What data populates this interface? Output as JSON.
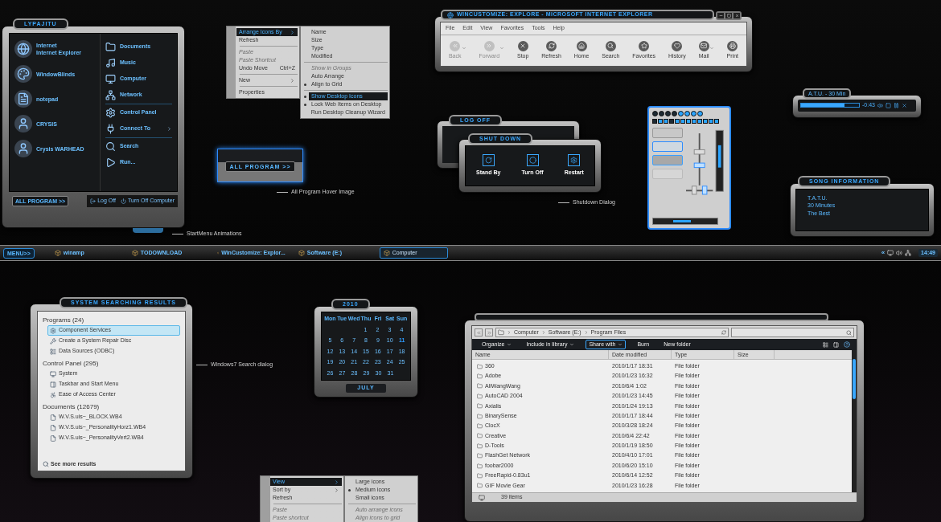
{
  "start_menu": {
    "user": "LYPAJITU",
    "pinned": [
      {
        "title": "Internet",
        "subtitle": "Internet Explorer"
      },
      {
        "title": "WindowBlinds"
      },
      {
        "title": "notepad"
      },
      {
        "title": "CRYSIS"
      },
      {
        "title": "Crysis WARHEAD"
      }
    ],
    "place_groups": [
      {
        "items": [
          {
            "label": "Documents",
            "has_submenu": false
          },
          {
            "label": "Music",
            "has_submenu": false
          },
          {
            "label": "Computer",
            "has_submenu": false
          },
          {
            "label": "Network",
            "has_submenu": false
          }
        ]
      },
      {
        "items": [
          {
            "label": "Control Panel",
            "has_submenu": false
          },
          {
            "label": "Connect To",
            "has_submenu": true
          }
        ]
      },
      {
        "items": [
          {
            "label": "Search",
            "has_submenu": false
          },
          {
            "label": "Run...",
            "has_submenu": false
          }
        ]
      }
    ],
    "all_programs": "ALL PROGRAM >>",
    "log_off": "Log Off",
    "turn_off": "Turn Off Computer",
    "note": "StartMenu Animations"
  },
  "desktop_menu": {
    "items": [
      {
        "kind": "item",
        "label": "Arrange Icons By",
        "selected": true,
        "disabled": false,
        "has_submenu": true
      },
      {
        "kind": "item",
        "label": "Refresh",
        "selected": false,
        "disabled": false,
        "has_submenu": false
      },
      {
        "kind": "separator"
      },
      {
        "kind": "item",
        "label": "Paste",
        "selected": false,
        "disabled": true,
        "has_submenu": false
      },
      {
        "kind": "item",
        "label": "Paste Shortcut",
        "selected": false,
        "disabled": true,
        "has_submenu": false
      },
      {
        "kind": "item",
        "label": "Undo Move",
        "shortcut": "Ctrl+Z",
        "selected": false,
        "disabled": false,
        "has_submenu": false
      },
      {
        "kind": "separator"
      },
      {
        "kind": "item",
        "label": "New",
        "selected": false,
        "disabled": false,
        "has_submenu": true
      },
      {
        "kind": "separator"
      },
      {
        "kind": "item",
        "label": "Properties",
        "selected": false,
        "disabled": false,
        "has_submenu": false
      }
    ],
    "submenu": [
      {
        "kind": "item",
        "label": "Name",
        "selected": false,
        "disabled": false,
        "checked": false
      },
      {
        "kind": "item",
        "label": "Size",
        "selected": false,
        "disabled": false,
        "checked": false
      },
      {
        "kind": "item",
        "label": "Type",
        "selected": false,
        "disabled": false,
        "checked": false
      },
      {
        "kind": "item",
        "label": "Modified",
        "selected": false,
        "disabled": false,
        "checked": false
      },
      {
        "kind": "separator"
      },
      {
        "kind": "item",
        "label": "Show in Groups",
        "selected": false,
        "disabled": true,
        "checked": false
      },
      {
        "kind": "item",
        "label": "Auto Arrange",
        "selected": false,
        "disabled": false,
        "checked": false
      },
      {
        "kind": "item",
        "label": "Align to Grid",
        "selected": false,
        "disabled": false,
        "checked": true
      },
      {
        "kind": "separator"
      },
      {
        "kind": "item",
        "label": "Show Desktop Icons",
        "selected": true,
        "disabled": false,
        "checked": true
      },
      {
        "kind": "item",
        "label": "Lock Web Items on Desktop",
        "selected": false,
        "disabled": false,
        "checked": true
      },
      {
        "kind": "item",
        "label": "Run Desktop Cleanup Wizard",
        "selected": false,
        "disabled": false,
        "checked": false
      }
    ]
  },
  "hover_preview": {
    "button": "ALL PROGRAM >>",
    "note": "All Program Hover Image"
  },
  "browser": {
    "title": "WINCUSTOMIZE: EXPLORE - MICROSOFT INTERNET EXPLORER",
    "menu": [
      "File",
      "Edit",
      "View",
      "Favorites",
      "Tools",
      "Help"
    ],
    "toolbar": [
      {
        "label": "Back",
        "disabled": true,
        "dropdown": true
      },
      {
        "label": "Forward",
        "disabled": true,
        "dropdown": true
      },
      {
        "label": "Stop",
        "disabled": false,
        "dropdown": false
      },
      {
        "label": "Refresh",
        "disabled": false,
        "dropdown": false
      },
      {
        "label": "Home",
        "disabled": false,
        "dropdown": false
      },
      {
        "label": "Search",
        "disabled": false,
        "dropdown": false
      },
      {
        "label": "Favorites",
        "disabled": false,
        "dropdown": false
      },
      {
        "label": "History",
        "disabled": false,
        "dropdown": false
      },
      {
        "label": "Mail",
        "disabled": false,
        "dropdown": true
      },
      {
        "label": "Print",
        "disabled": false,
        "dropdown": false
      }
    ]
  },
  "shutdown": {
    "log_off_title": "LOG OFF",
    "title": "SHUT DOWN",
    "buttons": [
      "Stand By",
      "Turn Off",
      "Restart"
    ],
    "note": "Shutdown Dialog"
  },
  "skin_controls": {
    "dots": [
      {
        "lit": false
      },
      {
        "lit": false
      },
      {
        "lit": false
      },
      {
        "lit": false
      },
      {
        "lit": true
      },
      {
        "lit": true
      },
      {
        "lit": true
      },
      {
        "lit": true
      }
    ],
    "squares": [
      {
        "lit": false
      },
      {
        "lit": true
      },
      {
        "lit": true
      },
      {
        "lit": false
      },
      {
        "lit": true
      },
      {
        "lit": true
      },
      {
        "lit": true
      },
      {
        "lit": true
      },
      {
        "lit": true
      },
      {
        "lit": true
      },
      {
        "lit": true
      },
      {
        "lit": true
      }
    ],
    "buttons": [
      {
        "kind": "normal"
      },
      {
        "kind": "hover"
      },
      {
        "kind": "pressed"
      },
      {
        "kind": "disabled"
      }
    ]
  },
  "player": {
    "title": "A.T.U. - 30 Min",
    "time": "-0:43",
    "level": 0.75
  },
  "song_info": {
    "title": "SONG INFORMATION",
    "lines": [
      "T.A.T.U.",
      "30 Minutes",
      "The Best"
    ]
  },
  "taskbar": {
    "start": "MENU>>",
    "tasks": [
      {
        "label": "winamp",
        "selected": false
      },
      {
        "label": "TODOWNLOAD",
        "selected": false
      },
      {
        "label": "WinCustomize: Explor...",
        "selected": false
      },
      {
        "label": "Software (E:)",
        "selected": false
      },
      {
        "label": "Computer",
        "selected": true
      }
    ],
    "tray_toggle": "«",
    "clock": "14:49"
  },
  "search": {
    "title": "SYSTEM SEARCHING RESULTS",
    "groups": [
      {
        "heading": "Programs (24)",
        "items": [
          {
            "label": "Component Services",
            "selected": true
          },
          {
            "label": "Create a System Repair Disc",
            "selected": false
          },
          {
            "label": "Data Sources (ODBC)",
            "selected": false
          }
        ]
      },
      {
        "heading": "Control Panel (295)",
        "items": [
          {
            "label": "System",
            "selected": false
          },
          {
            "label": "Taskbar and Start Menu",
            "selected": false
          },
          {
            "label": "Ease of Access Center",
            "selected": false
          }
        ]
      },
      {
        "heading": "Documents (12679)",
        "items": [
          {
            "label": "W.V.S.uis~_BLOCK.WB4",
            "selected": false
          },
          {
            "label": "W.V.S.uis~_PersonalityHorz1.WB4",
            "selected": false
          },
          {
            "label": "W.V.S.uis~_PersonalityVert2.WB4",
            "selected": false
          }
        ]
      }
    ],
    "more": "See more results",
    "note": "Windows7 Search dialog"
  },
  "calendar": {
    "year": "2010",
    "month": "JULY",
    "weekdays": [
      "Mon",
      "Tue",
      "Wed",
      "Thu",
      "Fri",
      "Sat",
      "Sun"
    ],
    "weeks": [
      {
        "right_aligned": true,
        "days": [
          {
            "day": "1",
            "highlighted": false
          },
          {
            "day": "2",
            "highlighted": false
          },
          {
            "day": "3",
            "highlighted": false
          },
          {
            "day": "4",
            "highlighted": false
          }
        ]
      },
      {
        "days": [
          {
            "day": "5",
            "highlighted": false
          },
          {
            "day": "6",
            "highlighted": false
          },
          {
            "day": "7",
            "highlighted": false
          },
          {
            "day": "8",
            "highlighted": false
          },
          {
            "day": "9",
            "highlighted": false
          },
          {
            "day": "10",
            "highlighted": false
          },
          {
            "day": "11",
            "highlighted": true
          }
        ]
      },
      {
        "days": [
          {
            "day": "12",
            "highlighted": false
          },
          {
            "day": "13",
            "highlighted": false
          },
          {
            "day": "14",
            "highlighted": false
          },
          {
            "day": "15",
            "highlighted": false
          },
          {
            "day": "16",
            "highlighted": false
          },
          {
            "day": "17",
            "highlighted": false
          },
          {
            "day": "18",
            "highlighted": false
          }
        ]
      },
      {
        "days": [
          {
            "day": "19",
            "highlighted": false
          },
          {
            "day": "20",
            "highlighted": false
          },
          {
            "day": "21",
            "highlighted": false
          },
          {
            "day": "22",
            "highlighted": false
          },
          {
            "day": "23",
            "highlighted": false
          },
          {
            "day": "24",
            "highlighted": false
          },
          {
            "day": "25",
            "highlighted": false
          }
        ]
      },
      {
        "right_aligned": false,
        "days": [
          {
            "day": "26",
            "highlighted": false
          },
          {
            "day": "27",
            "highlighted": false
          },
          {
            "day": "28",
            "highlighted": false
          },
          {
            "day": "29",
            "highlighted": false
          },
          {
            "day": "30",
            "highlighted": false
          },
          {
            "day": "31",
            "highlighted": false
          }
        ]
      }
    ]
  },
  "view_menu": {
    "items": [
      {
        "kind": "item",
        "label": "View",
        "selected": true,
        "disabled": false,
        "has_submenu": true
      },
      {
        "kind": "item",
        "label": "Sort by",
        "selected": false,
        "disabled": false,
        "has_submenu": true
      },
      {
        "kind": "item",
        "label": "Refresh",
        "selected": false,
        "disabled": false,
        "has_submenu": false
      },
      {
        "kind": "separator"
      },
      {
        "kind": "item",
        "label": "Paste",
        "selected": false,
        "disabled": true,
        "has_submenu": false
      },
      {
        "kind": "item",
        "label": "Paste shortcut",
        "selected": false,
        "disabled": true,
        "has_submenu": false
      }
    ],
    "submenu": [
      {
        "kind": "item",
        "label": "Large icons",
        "selected": false,
        "disabled": false,
        "checked": false
      },
      {
        "kind": "item",
        "label": "Medium icons",
        "selected": false,
        "disabled": false,
        "checked": true
      },
      {
        "kind": "item",
        "label": "Small icons",
        "selected": false,
        "disabled": false,
        "checked": false
      },
      {
        "kind": "separator"
      },
      {
        "kind": "item",
        "label": "Auto arrange icons",
        "selected": false,
        "disabled": true,
        "checked": false
      },
      {
        "kind": "item",
        "label": "Align icons to grid",
        "selected": false,
        "disabled": true,
        "checked": false
      }
    ]
  },
  "explorer": {
    "breadcrumb": [
      "Computer",
      "Software (E:)",
      "Program Files"
    ],
    "commands": [
      {
        "label": "Organize",
        "dropdown": true,
        "selected": false
      },
      {
        "label": "Include in library",
        "dropdown": true,
        "selected": false
      },
      {
        "label": "Share with",
        "dropdown": true,
        "selected": true
      },
      {
        "label": "Burn",
        "dropdown": false,
        "selected": false
      },
      {
        "label": "New folder",
        "dropdown": false,
        "selected": false
      }
    ],
    "columns": [
      "Name",
      "Date modified",
      "Type",
      "Size"
    ],
    "rows": [
      [
        "360",
        "2010/1/17 18:31",
        "File folder"
      ],
      [
        "Adobe",
        "2010/1/23 16:32",
        "File folder"
      ],
      [
        "AliWangWang",
        "2010/6/4 1:02",
        "File folder"
      ],
      [
        "AutoCAD 2004",
        "2010/1/23 14:45",
        "File folder"
      ],
      [
        "Axialis",
        "2010/1/24 19:13",
        "File folder"
      ],
      [
        "BinarySense",
        "2010/1/17 18:44",
        "File folder"
      ],
      [
        "ClocX",
        "2010/3/28 18:24",
        "File folder"
      ],
      [
        "Creative",
        "2010/6/4 22:42",
        "File folder"
      ],
      [
        "D-Tools",
        "2010/1/19 18:50",
        "File folder"
      ],
      [
        "FlashGet Network",
        "2010/4/10 17:01",
        "File folder"
      ],
      [
        "foobar2000",
        "2010/6/20 15:10",
        "File folder"
      ],
      [
        "FreeRapid-0.83u1",
        "2010/6/14 12:52",
        "File folder"
      ],
      [
        "GIF Movie Gear",
        "2010/1/23 16:28",
        "File folder"
      ]
    ],
    "status": "39 items"
  }
}
